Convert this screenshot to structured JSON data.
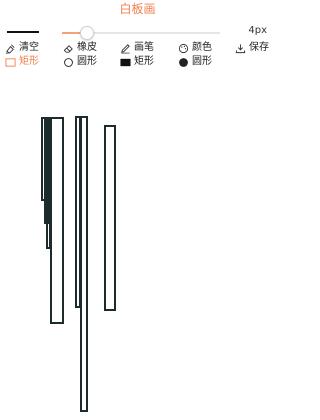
{
  "app": {
    "title": "白板画",
    "title_color": "#f0804f"
  },
  "toolbar": {
    "stroke_color": "#111111",
    "brush_size": 4,
    "brush_size_label": "4px",
    "brush_size_fraction": 0.15,
    "accent": "#f0a27d",
    "row1": [
      {
        "name": "clear",
        "label": "清空",
        "icon": "clear-icon",
        "active": false
      },
      {
        "name": "eraser",
        "label": "橡皮",
        "icon": "eraser-icon",
        "active": false
      },
      {
        "name": "pen",
        "label": "画笔",
        "icon": "pen-icon",
        "active": false
      },
      {
        "name": "color",
        "label": "颜色",
        "icon": "palette-icon",
        "active": false
      },
      {
        "name": "save",
        "label": "保存",
        "icon": "download-icon",
        "active": false
      }
    ],
    "row2": [
      {
        "name": "rect-outline",
        "label": "矩形",
        "icon": "rect-outline-icon",
        "active": true
      },
      {
        "name": "circle-outline",
        "label": "圆形",
        "icon": "circle-outline-icon",
        "active": false
      },
      {
        "name": "rect-filled",
        "label": "矩形",
        "icon": "rect-filled-icon",
        "active": false
      },
      {
        "name": "circle-filled",
        "label": "圆形",
        "icon": "circle-filled-icon",
        "active": false
      }
    ]
  },
  "canvas": {
    "stroke_color": "#1c2b2b"
  }
}
